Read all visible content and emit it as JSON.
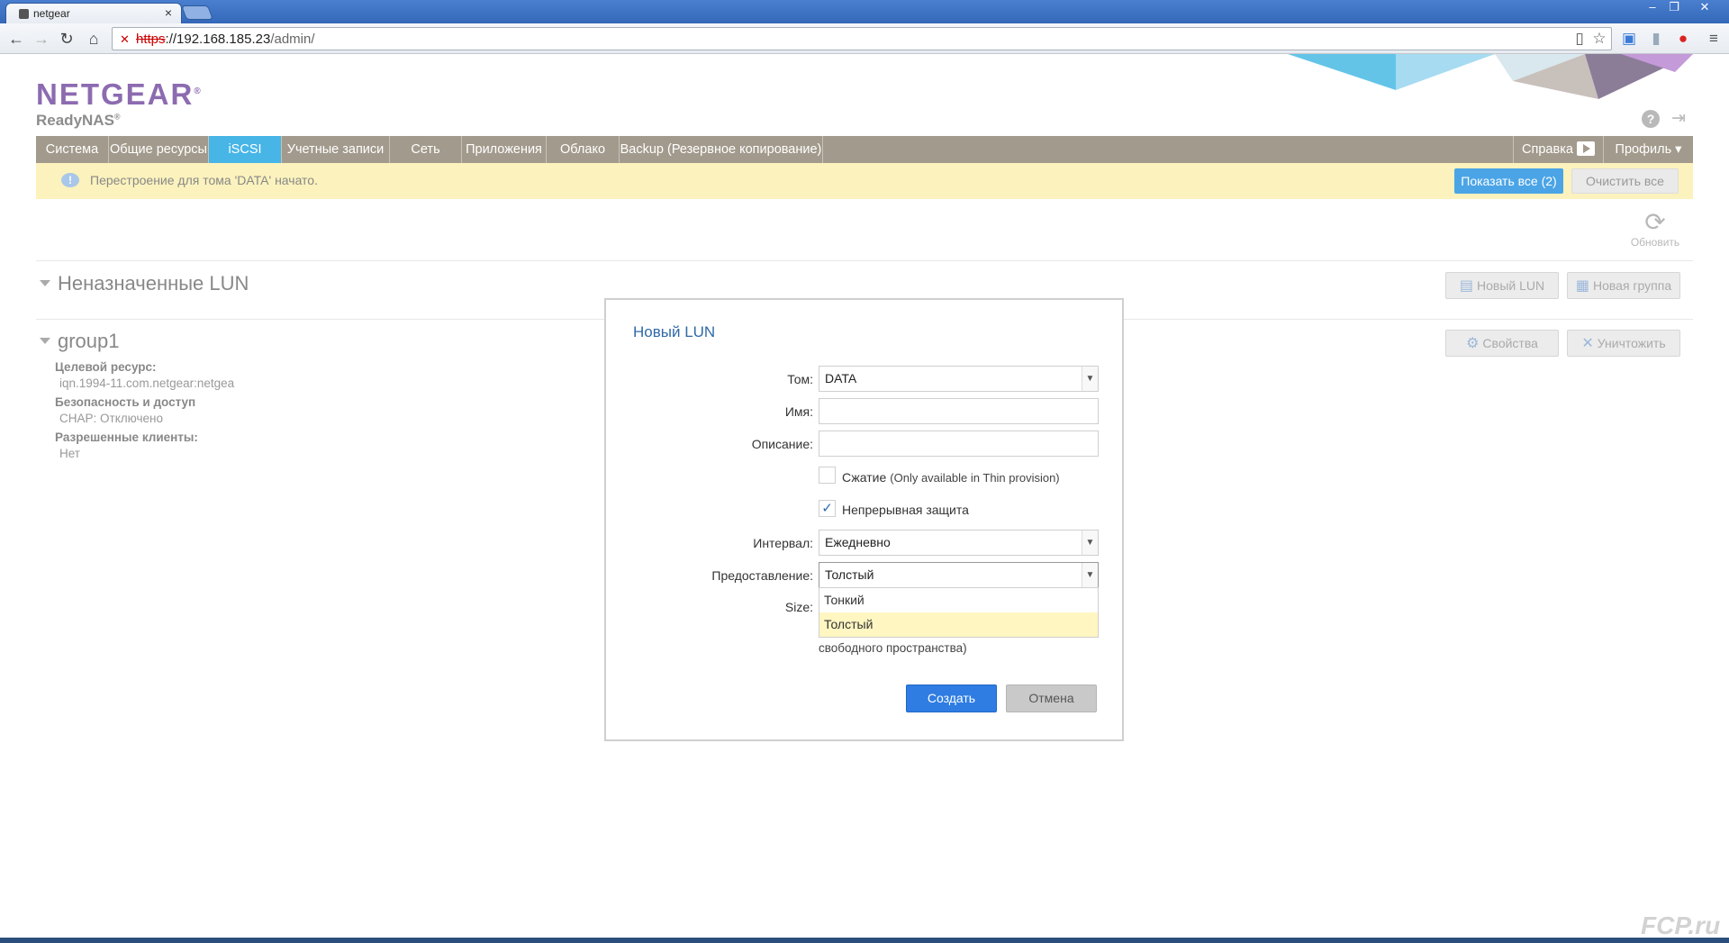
{
  "browser": {
    "tab_title": "netgear",
    "tab_close": "×",
    "url_scheme": "https",
    "url_host": "://192.168.185.23",
    "url_path": "/admin/",
    "window_controls": [
      "–",
      "❐",
      "✕"
    ]
  },
  "header": {
    "logo": "NETGEAR",
    "logo_mark": "®",
    "product": "ReadyNAS",
    "product_mark": "®",
    "help": "?"
  },
  "nav": {
    "items": [
      "Система",
      "Общие ресурсы",
      "iSCSI",
      "Учетные записи",
      "Сеть",
      "Приложения",
      "Облако",
      "Backup (Резервное копирование)"
    ],
    "active": "iSCSI",
    "help_label": "Справка",
    "profile_label": "Профиль ▾"
  },
  "notice": {
    "icon": "!",
    "text": "Перестроение для тома 'DATA' начато.",
    "show_all": "Показать все (2)",
    "clear_all": "Очистить все"
  },
  "refresh_label": "Обновить",
  "unassigned": {
    "title": "Неназначенные LUN",
    "new_lun": "Новый LUN",
    "new_group": "Новая группа"
  },
  "group": {
    "title": "group1",
    "properties": "Свойства",
    "destroy": "Уничтожить",
    "target_label": "Целевой ресурс:",
    "target_value": "iqn.1994-11.com.netgear:netgea",
    "security_label": "Безопасность и доступ",
    "security_value": "CHAP: Отключено",
    "clients_label": "Разрешенные клиенты:",
    "clients_value": "Нет"
  },
  "modal": {
    "title": "Новый LUN",
    "volume_label": "Том:",
    "volume_value": "DATA",
    "name_label": "Имя:",
    "name_value": "",
    "description_label": "Описание:",
    "description_value": "",
    "compression_label": "Сжатие",
    "compression_hint": "(Only available in Thin provision)",
    "compression_checked": false,
    "protection_label": "Непрерывная защита",
    "protection_checked": true,
    "interval_label": "Интервал:",
    "interval_value": "Ежедневно",
    "provision_label": "Предоставление:",
    "provision_value": "Толстый",
    "provision_options": [
      "Тонкий",
      "Толстый"
    ],
    "provision_highlighted": "Толстый",
    "size_label": "Size:",
    "size_note": "свободного пространства)",
    "create": "Создать",
    "cancel": "Отмена"
  },
  "watermark": "FCP.ru"
}
